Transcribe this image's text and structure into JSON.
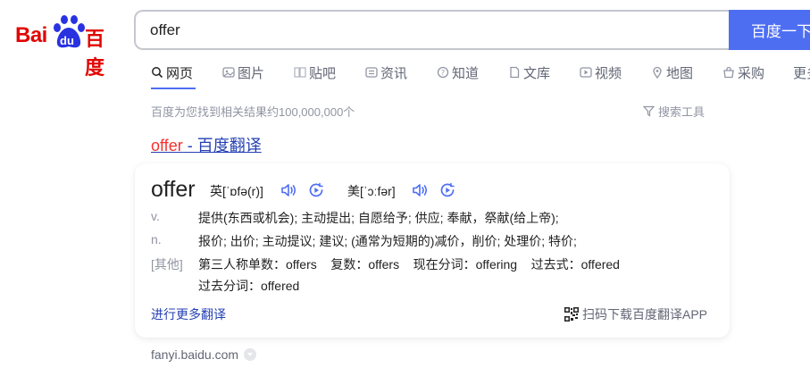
{
  "logo": {
    "bai": "Bai",
    "du": "du",
    "baidu_cn": "百度"
  },
  "search": {
    "value": "offer",
    "button_label": "百度一下"
  },
  "tabs": [
    {
      "label": "网页",
      "icon": "search-icon"
    },
    {
      "label": "图片",
      "icon": "image-icon"
    },
    {
      "label": "贴吧",
      "icon": "tieba-icon"
    },
    {
      "label": "资讯",
      "icon": "news-icon"
    },
    {
      "label": "知道",
      "icon": "question-icon"
    },
    {
      "label": "文库",
      "icon": "document-icon"
    },
    {
      "label": "视频",
      "icon": "video-icon"
    },
    {
      "label": "地图",
      "icon": "map-icon"
    },
    {
      "label": "采购",
      "icon": "shopping-icon"
    },
    {
      "label": "更多",
      "icon": ""
    }
  ],
  "result_count": "百度为您找到相关结果约100,000,000个",
  "search_tools": "搜索工具",
  "result": {
    "title_keyword": "offer",
    "title_rest": " - 百度翻译",
    "word": "offer",
    "uk_phonetic": "英[ˈɒfə(r)]",
    "us_phonetic": "美[ˈɔːfər]",
    "definitions": [
      {
        "pos": "v.",
        "text": "提供(东西或机会); 主动提出; 自愿给予; 供应; 奉献，祭献(给上帝);"
      },
      {
        "pos": "n.",
        "text": "报价; 出价; 主动提议; 建议; (通常为短期的)减价，削价; 处理价; 特价;"
      },
      {
        "pos": "[其他]",
        "text": "第三人称单数：offers    复数：offers    现在分词：offering    过去式：offered"
      },
      {
        "pos": "",
        "text": "过去分词：offered"
      }
    ],
    "more_link": "进行更多翻译",
    "app_download": "扫码下载百度翻译APP",
    "source": "fanyi.baidu.com"
  },
  "colors": {
    "brand_red": "#e10602",
    "brand_blue": "#2932e1",
    "accent": "#4e6ef2",
    "link": "#2440b3"
  }
}
